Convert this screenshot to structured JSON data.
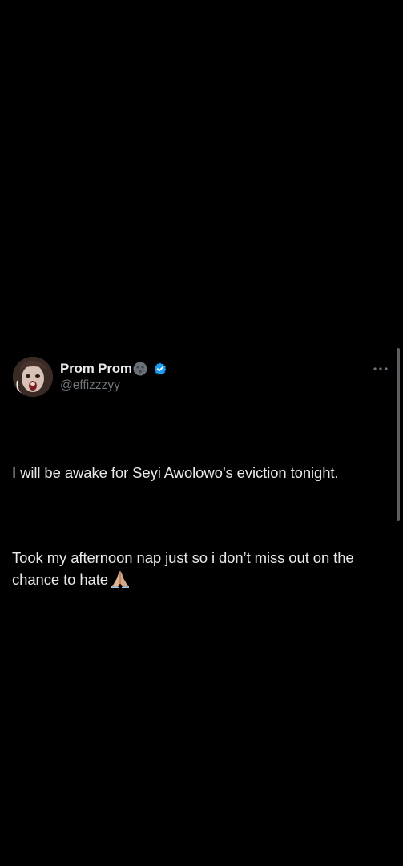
{
  "tweet": {
    "author": {
      "display_name": "Prom Prom",
      "handle": "@effizzzyy",
      "verified": true,
      "name_emoji": "dark-moon-face-emoji",
      "avatar": "avatar"
    },
    "more_icon": "more-horizontal-icon",
    "text": {
      "paragraph1": "I will be awake for Seyi Awolowo’s eviction tonight.",
      "paragraph2": "Took my afternoon nap just so i don’t miss out on the chance to hate",
      "trailing_emoji": "folded-hands-emoji"
    }
  },
  "colors": {
    "background": "#000000",
    "primary_text": "#e7e9ea",
    "secondary_text": "#71767b",
    "verified_blue": "#1d9bf0",
    "scrollbar": "#5c5f63"
  }
}
